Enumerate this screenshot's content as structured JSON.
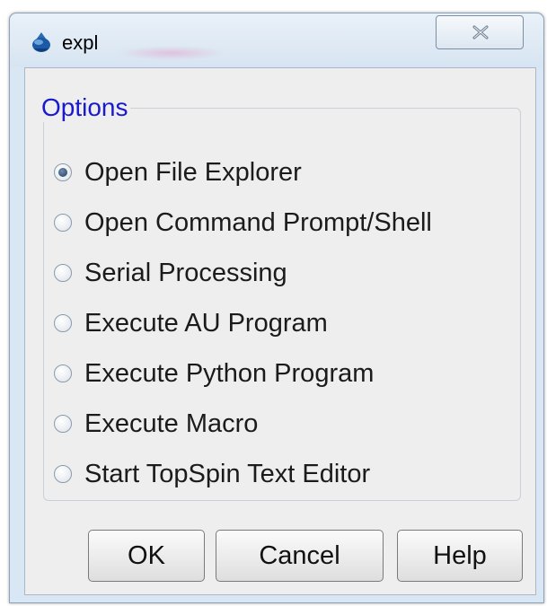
{
  "window": {
    "title": "expl",
    "app_icon": "topspin-app-icon",
    "close_icon": "close-icon"
  },
  "options": {
    "legend": "Options",
    "selected_index": 0,
    "items": [
      {
        "label": "Open File Explorer",
        "checked": true
      },
      {
        "label": "Open Command Prompt/Shell",
        "checked": false
      },
      {
        "label": "Serial Processing",
        "checked": false
      },
      {
        "label": "Execute AU Program",
        "checked": false
      },
      {
        "label": "Execute Python Program",
        "checked": false
      },
      {
        "label": "Execute Macro",
        "checked": false
      },
      {
        "label": "Start TopSpin Text Editor",
        "checked": false
      }
    ]
  },
  "buttons": {
    "ok": "OK",
    "cancel": "Cancel",
    "help": "Help"
  },
  "colors": {
    "legend": "#1a1acc",
    "frame": "#d9e6f3",
    "content_bg": "#eeeeee"
  }
}
